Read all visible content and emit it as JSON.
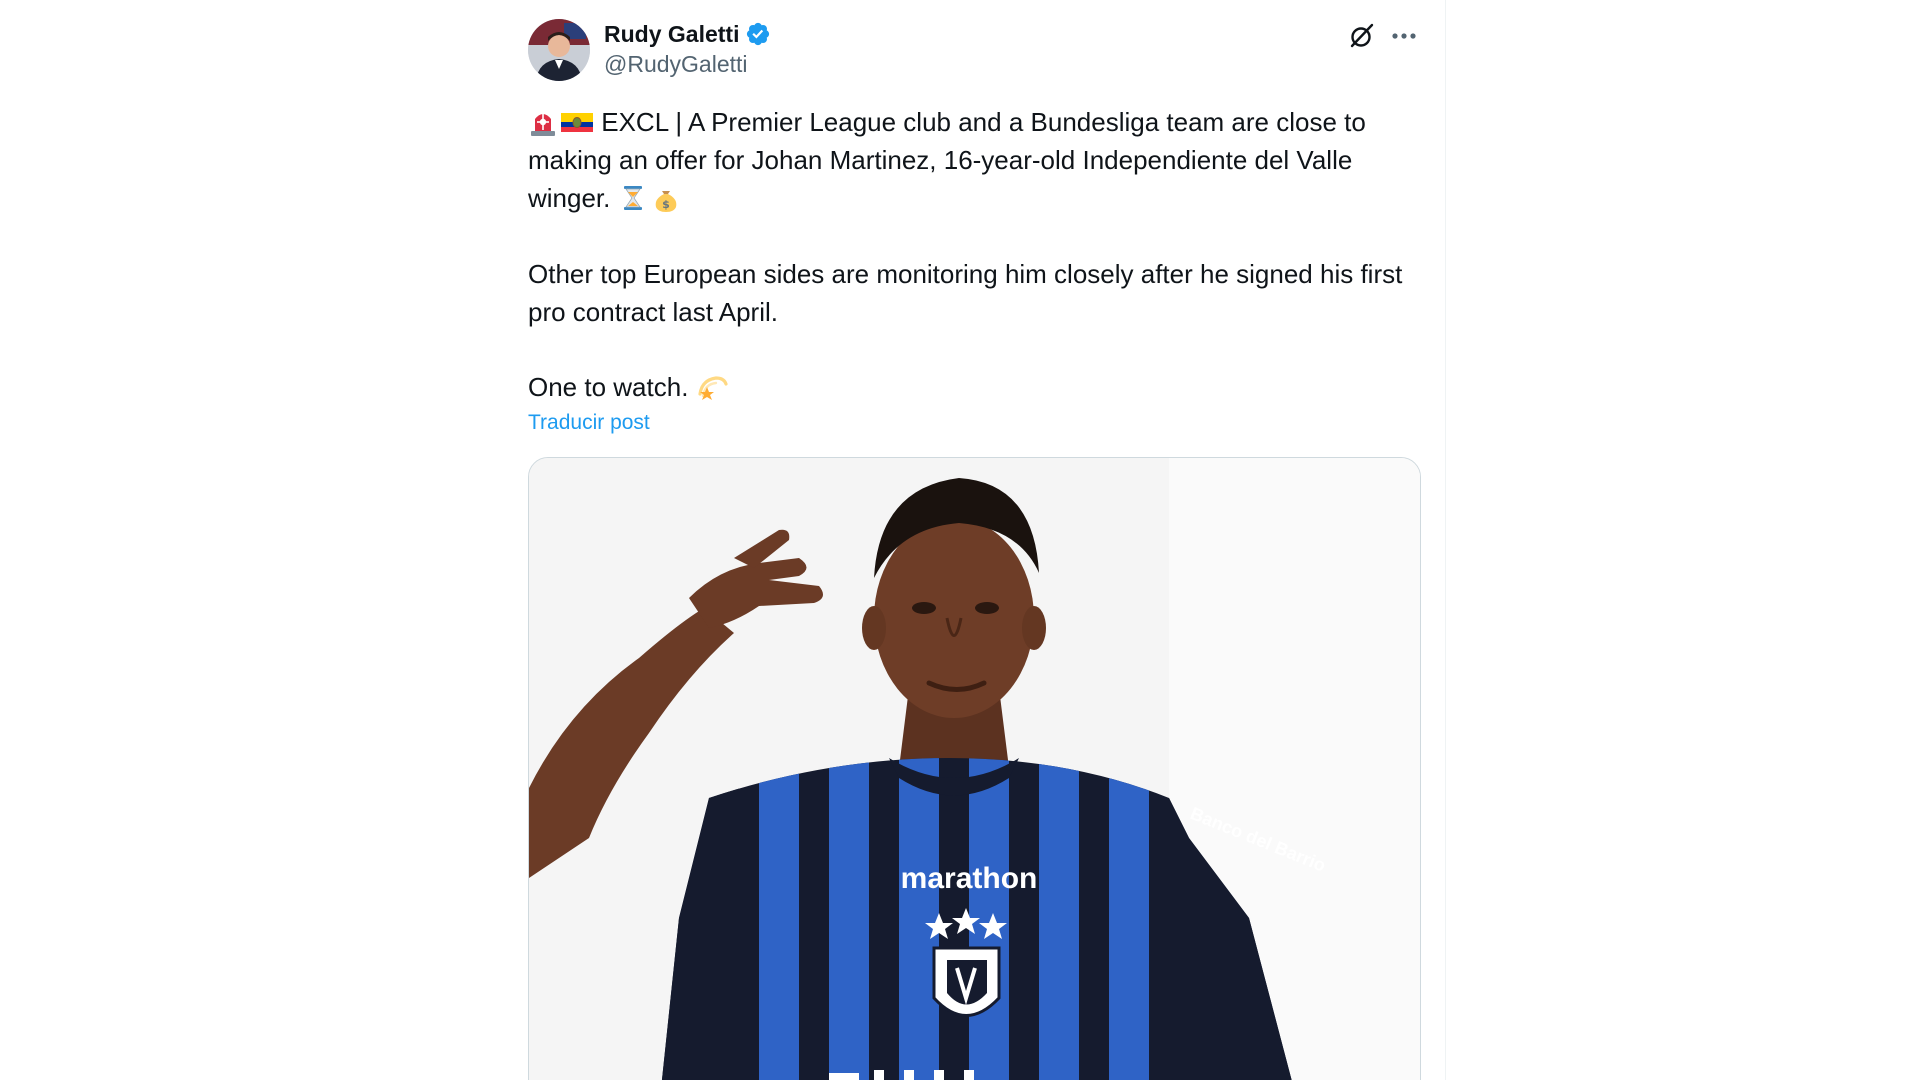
{
  "author": {
    "name": "Rudy Galetti",
    "handle": "@RudyGaletti"
  },
  "icons": {
    "verified": "verified-badge-icon",
    "grok": "grok-icon",
    "more": "more-options-icon",
    "siren": "rotating-light-emoji",
    "flag": "ecuador-flag-emoji",
    "hourglass": "hourglass-emoji",
    "money": "money-bag-emoji",
    "dizzy": "dizzy-star-emoji"
  },
  "tweet": {
    "line1": "EXCL | A Premier League club and a Bundesliga team are close to making an offer for Johan Martinez, 16-year-old Independiente del Valle winger.",
    "line2": "Other top European sides are monitoring him closely after he signed his first pro contract last April.",
    "line3": "One to watch."
  },
  "translate_label": "Traducir post",
  "media": {
    "shirt_sponsor": "marathon",
    "sleeve_sponsor": "Banco del Barrio"
  },
  "colors": {
    "link": "#1d9bf0",
    "verified": "#1d9bf0",
    "text": "#0f1419",
    "secondary": "#536471",
    "jersey_blue": "#2f63c6",
    "jersey_navy": "#151b2e"
  }
}
